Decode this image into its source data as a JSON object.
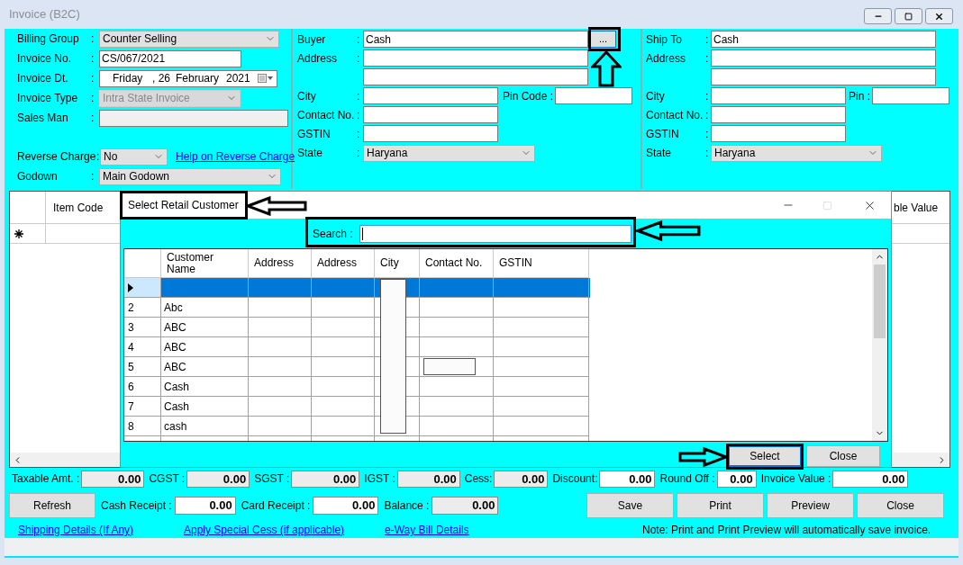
{
  "window": {
    "title": "Invoice (B2C)"
  },
  "billing": {
    "billing_group": {
      "label": "Billing Group",
      "colon": ":",
      "value": "Counter Selling"
    },
    "invoice_no": {
      "label": "Invoice No.",
      "colon": ":",
      "value": "CS/067/2021"
    },
    "invoice_date": {
      "label": "Invoice Dt.",
      "colon": ":",
      "weekday": "Friday",
      "day": ", 26",
      "month": "February",
      "year": "2021"
    },
    "invoice_type": {
      "label": "Invoice Type",
      "colon": ":",
      "value": "Intra State Invoice",
      "disabled": true
    },
    "sales_man": {
      "label": "Sales Man",
      "colon": ":",
      "disabled": true
    },
    "reverse_charge": {
      "label": "Reverse Charge",
      "colon": ":",
      "value": "No",
      "help_link": "Help on Reverse Charge"
    },
    "godown": {
      "label": "Godown",
      "colon": ":",
      "value": "Main Godown"
    }
  },
  "buyer": {
    "name": {
      "label": "Buyer",
      "colon": ":",
      "value": "Cash",
      "browse": "..."
    },
    "address": {
      "label": "Address",
      "colon": ":"
    },
    "city": {
      "label": "City",
      "colon": ":"
    },
    "pin": {
      "label": "Pin Code :"
    },
    "contact": {
      "label": "Contact No.",
      "colon": ":"
    },
    "gstin": {
      "label": "GSTIN",
      "colon": ":"
    },
    "state": {
      "label": "State",
      "colon": ":",
      "value": "Haryana"
    }
  },
  "ship_to": {
    "name": {
      "label": "Ship To",
      "colon": ":",
      "value": "Cash"
    },
    "address": {
      "label": "Address",
      "colon": ":"
    },
    "city": {
      "label": "City",
      "colon": ":"
    },
    "pin": {
      "label": "Pin :"
    },
    "contact": {
      "label": "Contact No.",
      "colon": ":"
    },
    "gstin": {
      "label": "GSTIN",
      "colon": ":"
    },
    "state": {
      "label": "State",
      "colon": ":",
      "value": "Haryana"
    }
  },
  "item_grid": {
    "columns": [
      "Item Code",
      "ble Value"
    ]
  },
  "dialog": {
    "title": "Select Retail Customer",
    "search": {
      "label": "Search :"
    },
    "columns": [
      "Customer Name",
      "Address",
      "Address",
      "City",
      "Contact No.",
      "GSTIN"
    ],
    "rows": [
      {
        "selected": true
      },
      {
        "num": "2",
        "name": "Abc",
        "selected": false
      },
      {
        "num": "3",
        "name": "ABC",
        "selected": false
      },
      {
        "num": "4",
        "name": "ABC",
        "selected": false
      },
      {
        "num": "5",
        "name": "ABC",
        "selected": false
      },
      {
        "num": "6",
        "name": "Cash",
        "selected": false
      },
      {
        "num": "7",
        "name": "Cash",
        "selected": false
      },
      {
        "num": "8",
        "name": "cash",
        "selected": false
      }
    ],
    "buttons": [
      {
        "label": "Select",
        "focused": true
      },
      {
        "label": "Close",
        "focused": false
      }
    ]
  },
  "totals": [
    {
      "label": "Taxable Amt. :",
      "value": "0.00",
      "editable": false
    },
    {
      "label": "CGST :",
      "value": "0.00",
      "editable": false
    },
    {
      "label": "SGST :",
      "value": "0.00",
      "editable": false
    },
    {
      "label": "IGST :",
      "value": "0.00",
      "editable": false
    },
    {
      "label": "Cess:",
      "value": "0.00",
      "editable": false
    },
    {
      "label": "Discount:",
      "value": "0.00",
      "editable": true
    },
    {
      "label": "Round Off :",
      "value": "0.00",
      "editable": true
    },
    {
      "label": "Invoice Value :",
      "value": "0.00",
      "editable": true
    }
  ],
  "receipts": {
    "refresh": "Refresh",
    "fields": [
      {
        "label": "Cash Receipt :",
        "value": "0.00",
        "editable": true
      },
      {
        "label": "Card Receipt :",
        "value": "0.00",
        "editable": true
      },
      {
        "label": "Balance :",
        "value": "0.00",
        "editable": false
      }
    ]
  },
  "actions": [
    "Save",
    "Print",
    "Preview",
    "Close"
  ],
  "links": [
    "Shipping Details (If Any)",
    "Apply Special Cess (if applicable)",
    "e-Way Bill Details"
  ],
  "note": "Note: Print and Print Preview will automatically save invoice."
}
